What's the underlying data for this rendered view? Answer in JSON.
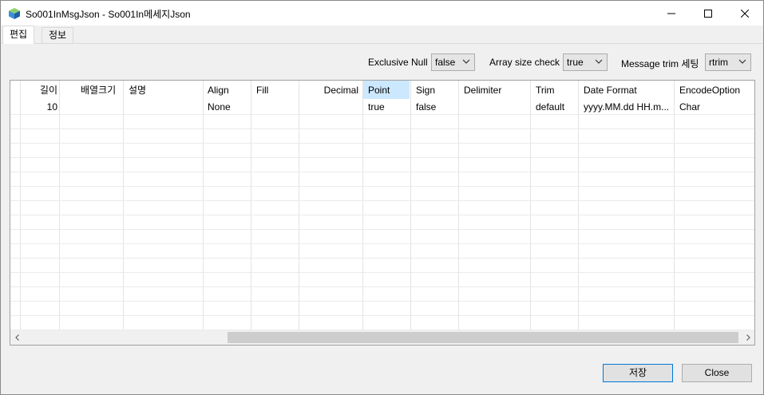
{
  "window": {
    "title": "So001InMsgJson - So001In메세지Json",
    "controls": {
      "minimize_icon": "minimize-icon",
      "maximize_icon": "maximize-icon",
      "close_icon": "close-icon"
    }
  },
  "tabs": [
    {
      "label": "편집",
      "active": true
    },
    {
      "label": "정보",
      "active": false
    }
  ],
  "options": {
    "exclusive_null": {
      "label": "Exclusive Null",
      "value": "false"
    },
    "array_size_check": {
      "label": "Array size check",
      "value": "true"
    },
    "message_trim": {
      "label": "Message trim 세팅",
      "value": "rtrim"
    }
  },
  "grid": {
    "columns": [
      "길이",
      "배열크기",
      "설명",
      "Align",
      "Fill",
      "Decimal",
      "Point",
      "Sign",
      "Delimiter",
      "Trim",
      "Date Format",
      "EncodeOption"
    ],
    "selected_column": "Point",
    "rows": [
      [
        "10",
        "",
        "",
        "None",
        "",
        "",
        "true",
        "false",
        "",
        "default",
        "yyyy.MM.dd HH.m...",
        "Char"
      ]
    ]
  },
  "buttons": {
    "save": "저장",
    "close": "Close"
  },
  "colors": {
    "selected_header": "#cce8ff",
    "default_button_border": "#0078d7"
  }
}
